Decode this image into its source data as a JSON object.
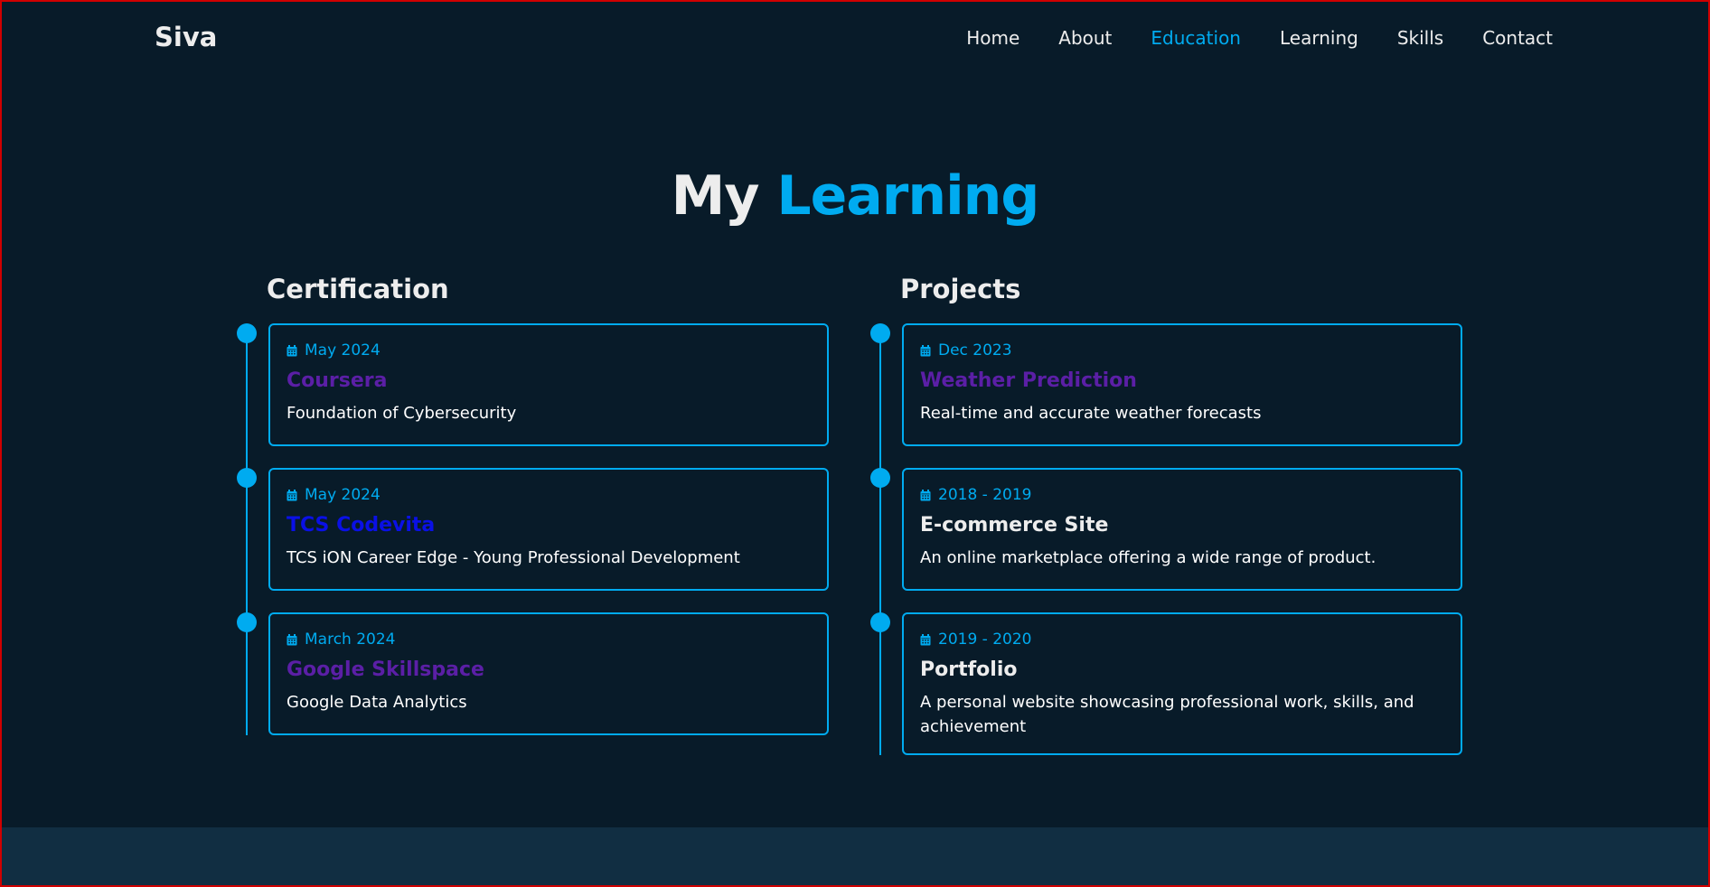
{
  "header": {
    "logo": "Siva",
    "nav": [
      {
        "label": "Home"
      },
      {
        "label": "About"
      },
      {
        "label": "Education"
      },
      {
        "label": "Learning"
      },
      {
        "label": "Skills"
      },
      {
        "label": "Contact"
      }
    ],
    "active_index": 2
  },
  "title": {
    "prefix": "My",
    "accent": "Learning"
  },
  "certification": {
    "heading": "Certification",
    "items": [
      {
        "date": "May 2024",
        "title": "Coursera",
        "title_color": "#5b1fa6",
        "description": "Foundation of Cybersecurity"
      },
      {
        "date": "May 2024",
        "title": "TCS Codevita",
        "title_color": "#0a10e6",
        "description": "TCS iON Career Edge - Young Professional Development"
      },
      {
        "date": "March 2024",
        "title": "Google Skillspace",
        "title_color": "#5b1fa6",
        "description": "Google Data Analytics"
      }
    ]
  },
  "projects": {
    "heading": "Projects",
    "items": [
      {
        "date": "Dec 2023",
        "title": "Weather Prediction",
        "title_color": "#5b1fa6",
        "description": "Real-time and accurate weather forecasts"
      },
      {
        "date": "2018 - 2019",
        "title": "E-commerce Site",
        "title_color": "#ededed",
        "description": "An online marketplace offering a wide range of product."
      },
      {
        "date": "2019 - 2020",
        "title": "Portfolio",
        "title_color": "#ededed",
        "description": "A personal website showcasing professional work, skills, and achievement"
      }
    ]
  },
  "colors": {
    "background": "#081b29",
    "accent": "#00abf0",
    "text": "#ededed",
    "footer_band": "#112e42"
  },
  "icons": {
    "date": "calendar-icon"
  }
}
